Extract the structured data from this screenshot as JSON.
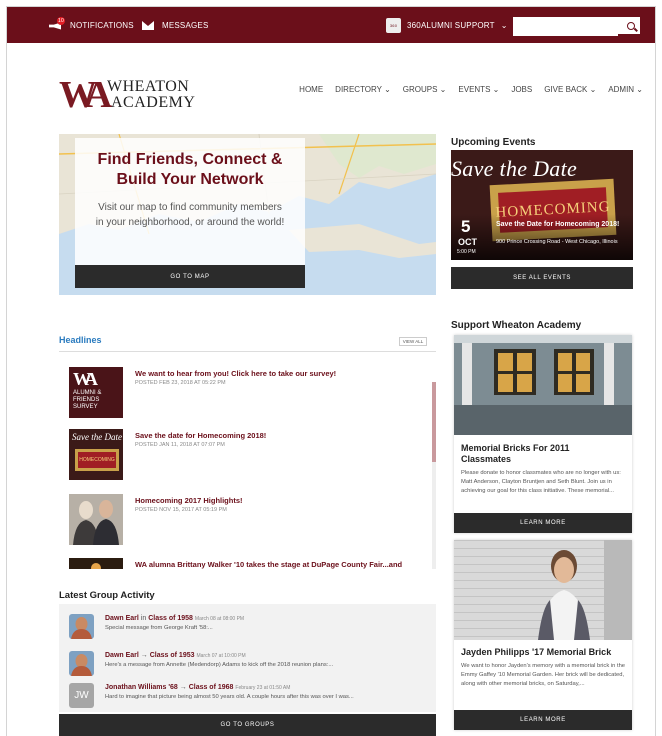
{
  "topbar": {
    "notifications_label": "NOTIFICATIONS",
    "notification_count": "10",
    "messages_label": "MESSAGES",
    "support_label": "360ALUMNI SUPPORT",
    "search_placeholder": ""
  },
  "brand": {
    "mark": "WA",
    "line1": "WHEATON",
    "line2": "ACADEMY"
  },
  "nav": [
    "HOME",
    "DIRECTORY ⌄",
    "GROUPS ⌄",
    "EVENTS ⌄",
    "JOBS",
    "GIVE BACK ⌄",
    "ADMIN ⌄"
  ],
  "hero": {
    "title_line1": "Find Friends, Connect &",
    "title_line2": "Build Your Network",
    "sub_line1": "Visit our map to find community members",
    "sub_line2": "in your neighborhood, or around the world!",
    "button": "GO TO MAP"
  },
  "events": {
    "heading": "Upcoming Events",
    "image_headline": "Save the Date",
    "image_ticket": "HOMECOMING",
    "day": "5",
    "month": "OCT",
    "time": "5:00 PM",
    "title": "Save the Date for Homecoming 2018!",
    "location": "900 Prince Crossing Road - West Chicago, Illinois",
    "button": "SEE ALL EVENTS"
  },
  "support": {
    "heading": "Support Wheaton Academy",
    "cards": [
      {
        "title_line1": "Memorial Bricks For 2011",
        "title_line2": "Classmates",
        "text": "Please donate to honor classmates who are no longer with us: Matt Anderson, Clayton Bruntjen and Seth Blunt. Join us in achieving our goal for this class initiative. These memorial...",
        "button": "LEARN MORE"
      },
      {
        "title_line1": "Jayden Philipps '17 Memorial Brick",
        "title_line2": "",
        "text": "We want to honor Jayden's memory with a memorial brick in the Emmy Gaffey '10 Memorial Garden. Her brick will be dedicated, along with other memorial bricks, on Saturday,...",
        "button": "LEARN MORE"
      }
    ]
  },
  "headlines": {
    "heading": "Headlines",
    "view_all": "VIEW ALL",
    "thumb1_text_mark": "WA",
    "thumb1_text": "ALUMNI & FRIENDS SURVEY",
    "items": [
      {
        "title": "We want to hear from you! Click here to take our survey!",
        "date": "POSTED FEB 23, 2018 AT 05:22 PM"
      },
      {
        "title": "Save the date for Homecoming 2018!",
        "date": "POSTED JAN 11, 2018 AT 07:07 PM"
      },
      {
        "title": "Homecoming 2017 Highlights!",
        "date": "POSTED NOV 15, 2017 AT 05:19 PM"
      },
      {
        "title": "WA alumna Brittany Walker '10 takes the stage at DuPage County Fair...and",
        "date": ""
      }
    ]
  },
  "group_activity": {
    "heading": "Latest Group Activity",
    "items": [
      {
        "name": "Dawn Earl",
        "sep": " in ",
        "group": "Class of 1958",
        "date": "March 08 at 08:00 PM",
        "msg": "Special message from George Kraft '58:..."
      },
      {
        "name": "Dawn Earl",
        "sep": " → ",
        "group": "Class of 1953",
        "date": "March 07 at 10:00 PM",
        "msg": "Here's a message from Annette (Medendorp) Adams to kick off the 2018 reunion plans:..."
      },
      {
        "name": "Jonathan Williams '68",
        "sep": " → ",
        "group": "Class of 1968",
        "date": "February 23 at 01:50 AM",
        "msg": "Hard to imagine that picture being almost 50 years old. A couple hours after this was over I was..."
      }
    ],
    "initials": "JW",
    "button": "GO TO GROUPS"
  },
  "colors": {
    "brand": "#6b0f1a",
    "dark_button": "#2b2b2b",
    "link_blue": "#2a7bbf"
  }
}
